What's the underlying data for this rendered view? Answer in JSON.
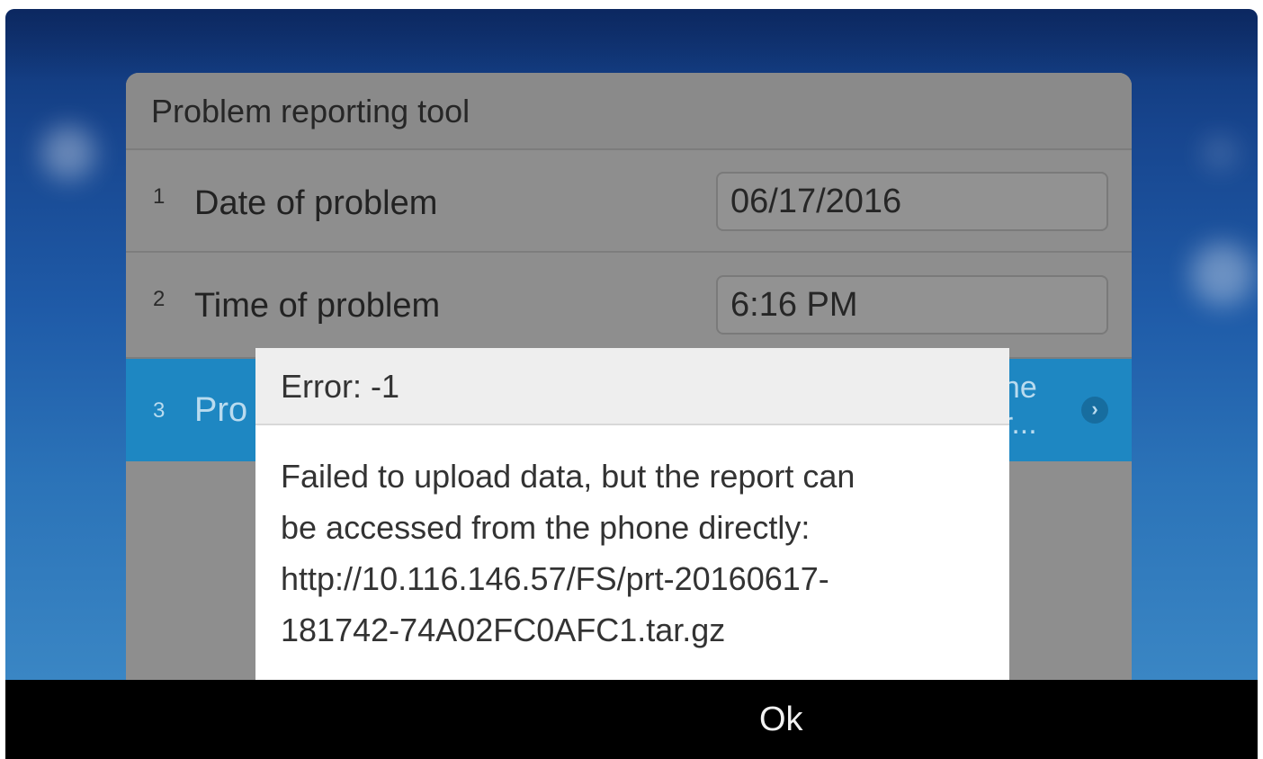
{
  "panel": {
    "title": "Problem reporting tool",
    "rows": [
      {
        "num": "1",
        "label": "Date of problem",
        "value": "06/17/2016"
      },
      {
        "num": "2",
        "label": "Time of problem",
        "value": "6:16 PM"
      },
      {
        "num": "3",
        "label": "Pro",
        "value_lines": [
          "one",
          "or..."
        ]
      }
    ]
  },
  "dialog": {
    "title": "Error: -1",
    "message_lines": [
      "Failed to upload data, but the report can",
      "be accessed from the phone directly:",
      "http://10.116.146.57/FS/prt-20160617-",
      "181742-74A02FC0AFC1.tar.gz"
    ]
  },
  "softkeys": {
    "ok_label": "Ok"
  },
  "icons": {
    "row3_chevron": "chevron-right-icon"
  },
  "colors": {
    "accent_selected_row": "#1e87c2",
    "softkey_bar": "#000000",
    "dialog_bg": "#ffffff"
  }
}
